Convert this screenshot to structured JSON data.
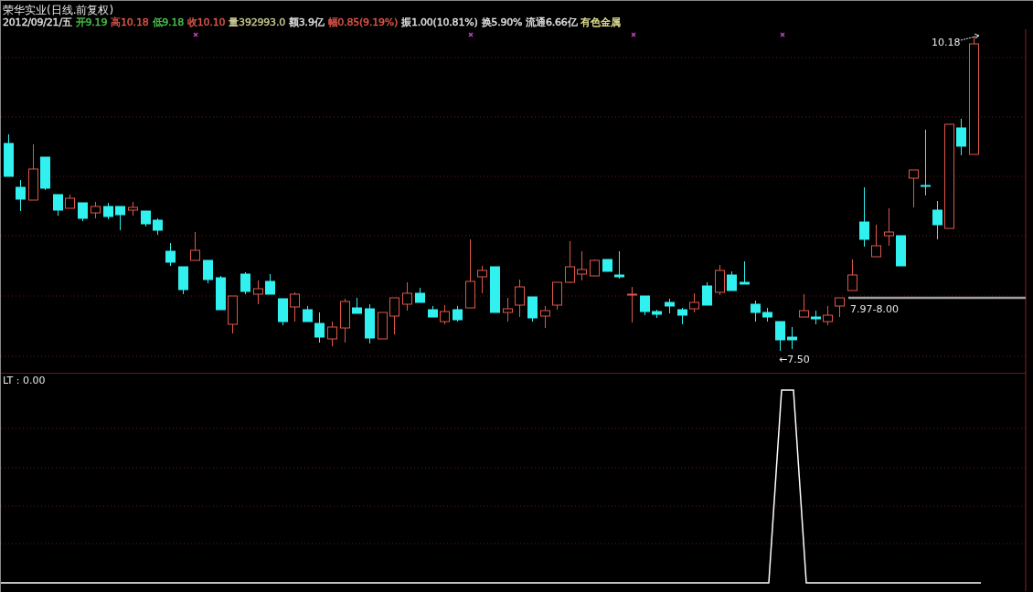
{
  "title": "荣华实业(日线.前复权)",
  "quote": [
    {
      "text": "2012/09/21/五",
      "color": "#e0e0e0"
    },
    {
      "text": "开9.19",
      "color": "#4cc24c"
    },
    {
      "text": "高10.18",
      "color": "#e0574a"
    },
    {
      "text": "低9.18",
      "color": "#4cc24c"
    },
    {
      "text": "收10.10",
      "color": "#e0574a"
    },
    {
      "text": "量392993.0",
      "color": "#c8c890"
    },
    {
      "text": "额3.9亿",
      "color": "#e0e0e0"
    },
    {
      "text": "幅0.85(9.19%)",
      "color": "#e0574a"
    },
    {
      "text": "振1.00(10.81%)",
      "color": "#e0e0e0"
    },
    {
      "text": "换5.90%",
      "color": "#e0e0e0"
    },
    {
      "text": "流通6.66亿",
      "color": "#e0e0e0"
    },
    {
      "text": "有色金属",
      "color": "#e0e090"
    }
  ],
  "chart_labels": {
    "high": "10.18",
    "low": "←7.50",
    "range": "7.97-8.00"
  },
  "indicator": {
    "label": "LT : 0.00"
  }
}
